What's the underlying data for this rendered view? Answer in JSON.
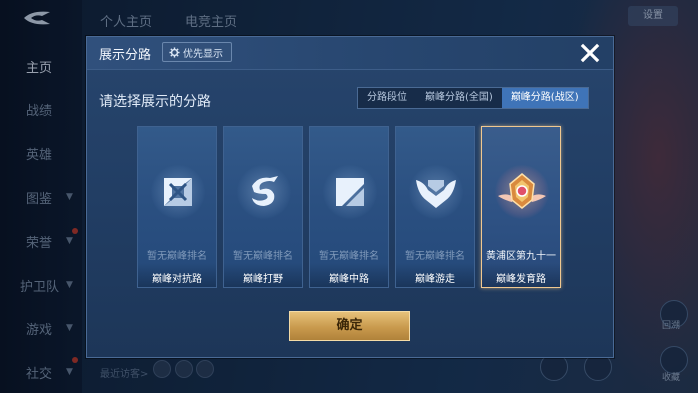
{
  "background": {
    "top_tabs": [
      "个人主页",
      "电竞主页"
    ],
    "sidebar": [
      {
        "label": "主页",
        "active": true,
        "chevron": false
      },
      {
        "label": "战绩",
        "active": false,
        "chevron": false
      },
      {
        "label": "英雄",
        "active": false,
        "chevron": false
      },
      {
        "label": "图鉴",
        "active": false,
        "chevron": true
      },
      {
        "label": "荣誉",
        "active": false,
        "chevron": true
      },
      {
        "label": "护卫队",
        "active": false,
        "chevron": true
      },
      {
        "label": "游戏",
        "active": false,
        "chevron": true
      },
      {
        "label": "社交",
        "active": false,
        "chevron": true
      }
    ],
    "top_right_button": "设置",
    "recent_visitors": "最近访客>",
    "right_labels": [
      "回溯",
      "收藏"
    ]
  },
  "modal": {
    "title": "展示分路",
    "priority_button": "优先显示",
    "prompt": "请选择展示的分路",
    "tabs": [
      {
        "label": "分路段位",
        "active": false
      },
      {
        "label": "巅峰分路(全国)",
        "active": false
      },
      {
        "label": "巅峰分路(战区)",
        "active": true
      }
    ],
    "cards": [
      {
        "role": "巅峰对抗路",
        "rank": "暂无巅峰排名",
        "icon": "clash-lane-icon",
        "selected": false
      },
      {
        "role": "巅峰打野",
        "rank": "暂无巅峰排名",
        "icon": "jungle-icon",
        "selected": false
      },
      {
        "role": "巅峰中路",
        "rank": "暂无巅峰排名",
        "icon": "mid-lane-icon",
        "selected": false
      },
      {
        "role": "巅峰游走",
        "rank": "暂无巅峰排名",
        "icon": "roam-icon",
        "selected": false
      },
      {
        "role": "巅峰发育路",
        "rank": "黄浦区第九十一",
        "icon": "farm-lane-badge-icon",
        "selected": true
      }
    ],
    "confirm_label": "确定"
  },
  "colors": {
    "accent_tab": "#3f74b8",
    "selected_border": "#f0c890",
    "confirm_gold": "#c99a4d"
  }
}
